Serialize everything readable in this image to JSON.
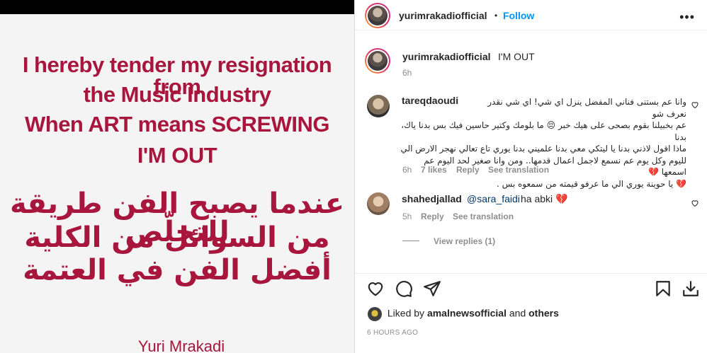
{
  "image": {
    "english_lines": [
      "I hereby tender my resignation from",
      "the Music Industry",
      "When ART means SCREWING",
      "I'M OUT"
    ],
    "arabic_lines": [
      "عندما يصبح الفن طريقة للتخلّص",
      "من السوائل من الكلية",
      "أفضل الفن في العتمة"
    ],
    "signature": "Yuri Mrakadi"
  },
  "header": {
    "username": "yurimrakadiofficial",
    "separator": "•",
    "follow_label": "Follow",
    "more_icon": "ellipsis-icon"
  },
  "caption": {
    "username": "yurimrakadiofficial",
    "text": "I'M OUT",
    "time": "6h"
  },
  "comments": [
    {
      "username": "tareqdaoudi",
      "lines": [
        "وانا عم بستنى فناني المفضل ينزل اي شي! اي شي نقدر نعرف شو",
        "عم بخبيلنا بقوم بصحى على هيك خبر 😔 ما بلومك وكتير حاسين فيك بس بدنا ياك، بدنا",
        "ماذا اقول لاذني بدنا يا ليتكي معي بدنا علميني بدنا يوري تاع تعالي نهجر الارض الي",
        "لليوم وكل يوم عم نسمع لاجمل اعمال قدمها.. ومن وانا صغير لحد اليوم عم اسمعها 💔",
        "💔 يا حوينة يوري الي ما عرفو قيمته من سمعوه بس ."
      ],
      "time": "6h",
      "likes": "7 likes",
      "reply": "Reply",
      "translate": "See translation"
    },
    {
      "username": "shahedjallad",
      "mention": "@sara_faidi",
      "text": "ha abki 💔",
      "time": "5h",
      "reply": "Reply",
      "translate": "See translation",
      "view_replies": "View replies (1)"
    }
  ],
  "actions": {
    "like_icon": "heart-icon",
    "comment_icon": "comment-icon",
    "share_icon": "share-icon",
    "save_icon": "bookmark-icon",
    "download_icon": "download-icon"
  },
  "likes": {
    "prefix": "Liked by",
    "user": "amalnewsofficial",
    "conj": "and",
    "others": "others"
  },
  "posted": "6 HOURS AGO"
}
